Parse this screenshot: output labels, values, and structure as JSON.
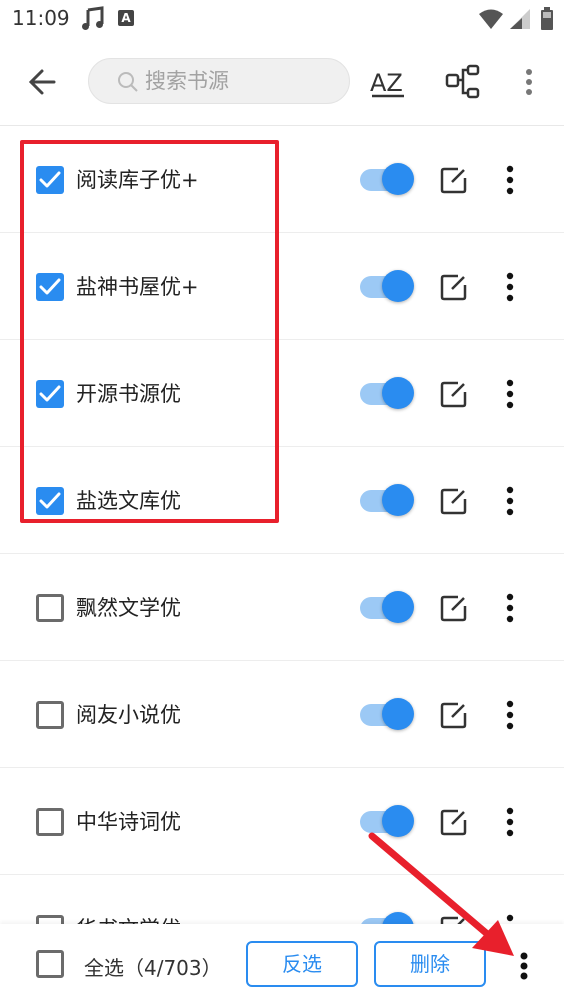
{
  "status_bar": {
    "time": "11:09",
    "icons": [
      "music-note-icon",
      "app-a-icon",
      "wifi-icon",
      "signal-icon",
      "battery-icon"
    ]
  },
  "toolbar": {
    "back_icon": "arrow-left-icon",
    "search_placeholder": "搜索书源",
    "sort_label": "AZ",
    "group_icon": "group-icon",
    "more_icon": "more-vert-icon"
  },
  "sources": [
    {
      "name": "阅读库子优+",
      "checked": true,
      "enabled": true
    },
    {
      "name": "盐神书屋优+",
      "checked": true,
      "enabled": true
    },
    {
      "name": "开源书源优",
      "checked": true,
      "enabled": true
    },
    {
      "name": "盐选文库优",
      "checked": true,
      "enabled": true
    },
    {
      "name": "飘然文学优",
      "checked": false,
      "enabled": true
    },
    {
      "name": "阅友小说优",
      "checked": false,
      "enabled": true
    },
    {
      "name": "中华诗词优",
      "checked": false,
      "enabled": true
    },
    {
      "name": "华书文学优",
      "checked": false,
      "enabled": true
    }
  ],
  "bottom_bar": {
    "select_all_label": "全选（4/703）",
    "invert_label": "反选",
    "delete_label": "删除"
  },
  "colors": {
    "accent": "#2a8cf0",
    "annotation": "#e8202c"
  }
}
